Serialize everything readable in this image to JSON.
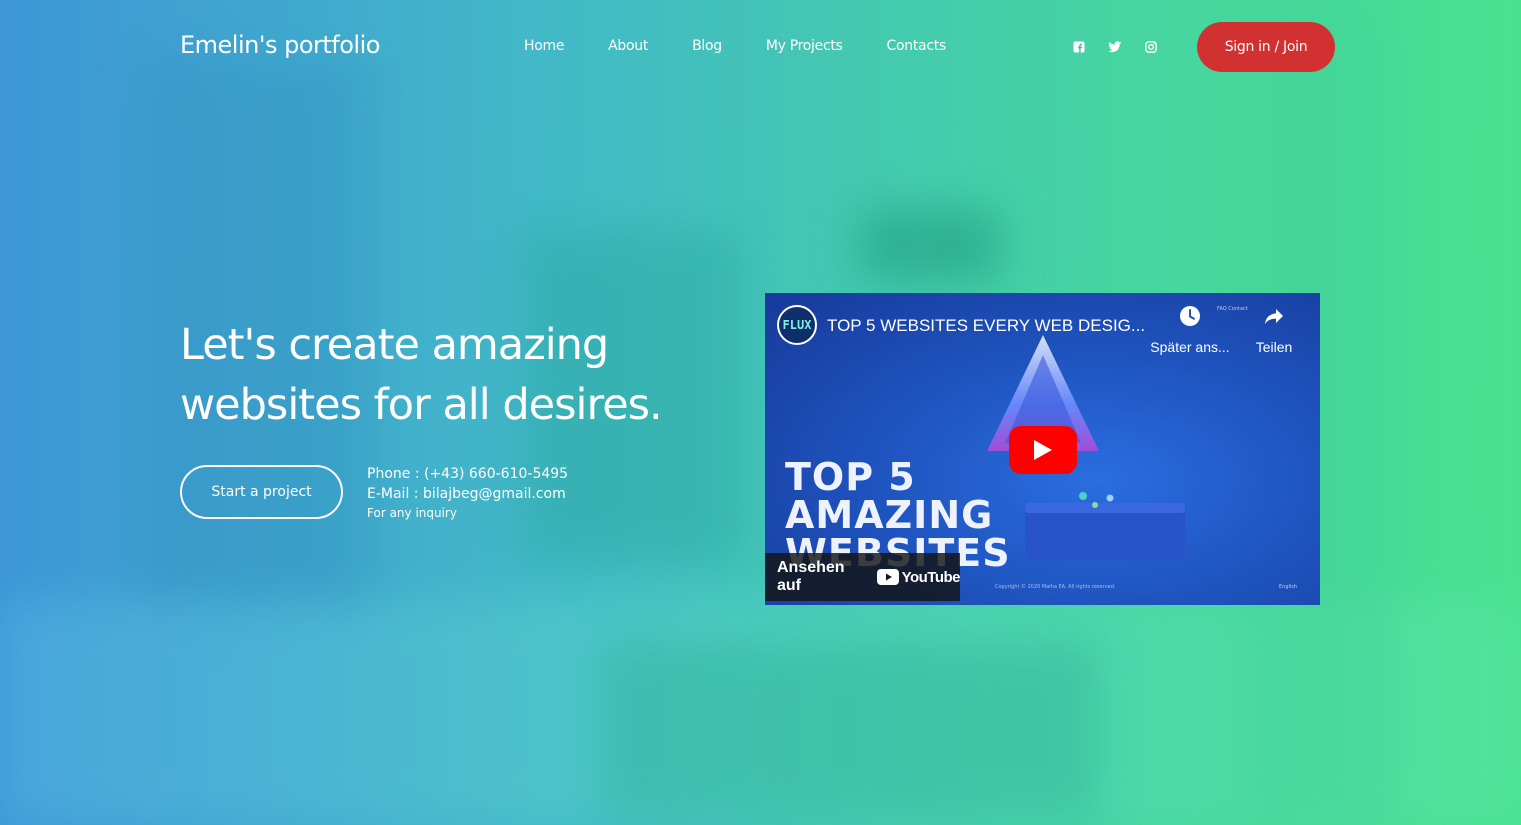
{
  "brand": {
    "name": "Emelin's portfolio"
  },
  "nav": {
    "items": [
      {
        "label": "Home"
      },
      {
        "label": "About"
      },
      {
        "label": "Blog"
      },
      {
        "label": "My Projects"
      },
      {
        "label": "Contacts"
      }
    ]
  },
  "social": {
    "icons": [
      "facebook-icon",
      "twitter-icon",
      "instagram-icon"
    ]
  },
  "header": {
    "signin_label": "Sign in / Join",
    "signin_color": "#d23131"
  },
  "hero": {
    "title_line1": "Let's create amazing",
    "title_line2": "websites for all desires.",
    "cta_label": "Start a project",
    "phone": "Phone : (+43) 660-610-5495",
    "email": "E-Mail : bilajbeg@gmail.com",
    "inquiry": "For any inquiry"
  },
  "video": {
    "title": "TOP 5 WEBSITES EVERY WEB DESIG...",
    "watch_later": "Später ans...",
    "share": "Teilen",
    "thumbnail_line1": "TOP 5",
    "thumbnail_line2": "AMAZING",
    "thumbnail_line3": "WEBSITES",
    "watch_on": "Ansehen auf",
    "youtube": "YouTube",
    "mini_nav": "FAQ   Contact",
    "copyright": "Copyright © 2020 Maiha EA. All rights reserved.",
    "lang": "English"
  }
}
